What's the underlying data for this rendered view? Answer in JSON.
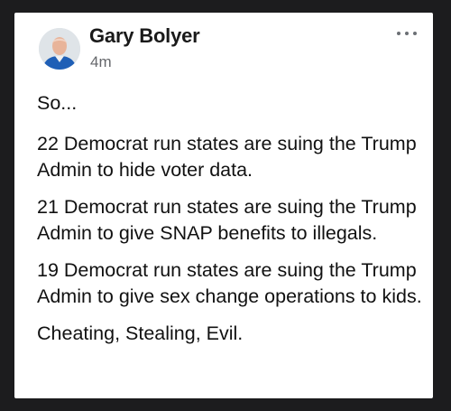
{
  "post": {
    "author": "Gary Bolyer",
    "time": "4m",
    "paragraphs": [
      "So...",
      "22 Democrat run states are suing the Trump Admin to hide voter data.",
      "21 Democrat run states are suing the Trump Admin to give SNAP benefits to illegals.",
      "19 Democrat run states are suing the Trump Admin to give sex change operations to kids.",
      "Cheating, Stealing, Evil."
    ]
  },
  "icons": {
    "avatar": "profile-photo",
    "more": "more-options-icon"
  },
  "colors": {
    "background": "#1c1c1e",
    "card": "#ffffff",
    "text": "#111111",
    "muted": "#65676b"
  }
}
